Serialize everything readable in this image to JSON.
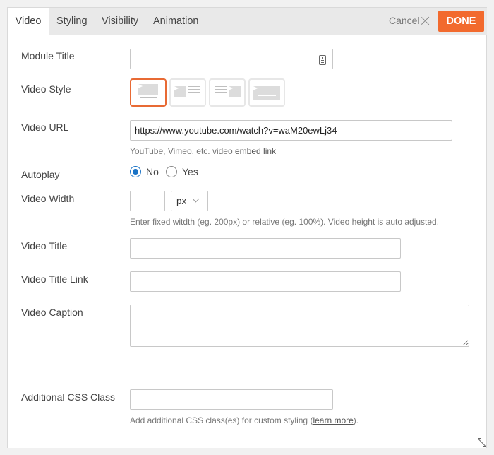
{
  "tabs": [
    {
      "label": "Video",
      "active": true
    },
    {
      "label": "Styling",
      "active": false
    },
    {
      "label": "Visibility",
      "active": false
    },
    {
      "label": "Animation",
      "active": false
    }
  ],
  "header": {
    "cancel_label": "Cancel",
    "done_label": "DONE"
  },
  "colors": {
    "accent": "#f26a2e",
    "radio_blue": "#1a73c6"
  },
  "form": {
    "module_title": {
      "label": "Module Title",
      "value": ""
    },
    "video_style": {
      "label": "Video Style",
      "selected_index": 0
    },
    "video_url": {
      "label": "Video URL",
      "value": "https://www.youtube.com/watch?v=waM20ewLj34",
      "help_text": "YouTube, Vimeo, etc. video ",
      "help_link": "embed link"
    },
    "autoplay": {
      "label": "Autoplay",
      "options": [
        "No",
        "Yes"
      ],
      "selected": "No"
    },
    "video_width": {
      "label": "Video Width",
      "value": "",
      "unit": "px",
      "help_text": "Enter fixed witdth (eg. 200px) or relative (eg. 100%). Video height is auto adjusted."
    },
    "video_title": {
      "label": "Video Title",
      "value": ""
    },
    "video_title_link": {
      "label": "Video Title Link",
      "value": ""
    },
    "video_caption": {
      "label": "Video Caption",
      "value": ""
    },
    "css_class": {
      "label": "Additional CSS Class",
      "value": "",
      "help_pre": "Add additional CSS class(es) for custom styling (",
      "help_link": "learn more",
      "help_post": ")."
    }
  }
}
